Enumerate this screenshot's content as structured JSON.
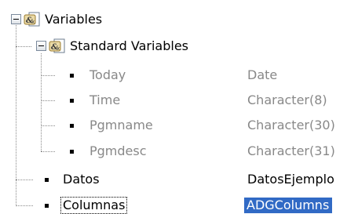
{
  "tree": {
    "root": {
      "label": "Variables",
      "icon": "variable-group-icon",
      "expanded": true,
      "children": {
        "standard": {
          "label": "Standard Variables",
          "icon": "variable-group-icon",
          "expanded": true,
          "items": [
            {
              "name": "Today",
              "type": "Date"
            },
            {
              "name": "Time",
              "type": "Character(8)"
            },
            {
              "name": "Pgmname",
              "type": "Character(30)"
            },
            {
              "name": "Pgmdesc",
              "type": "Character(31)"
            }
          ]
        },
        "user_items": [
          {
            "name": "Datos",
            "type": "DatosEjemplo"
          },
          {
            "name": "Columnas",
            "type": "ADGColumns",
            "selected": true
          }
        ]
      }
    }
  },
  "colors": {
    "selection": "#316ac5",
    "disabled_text": "#888888",
    "connector": "#8a8a8a"
  }
}
